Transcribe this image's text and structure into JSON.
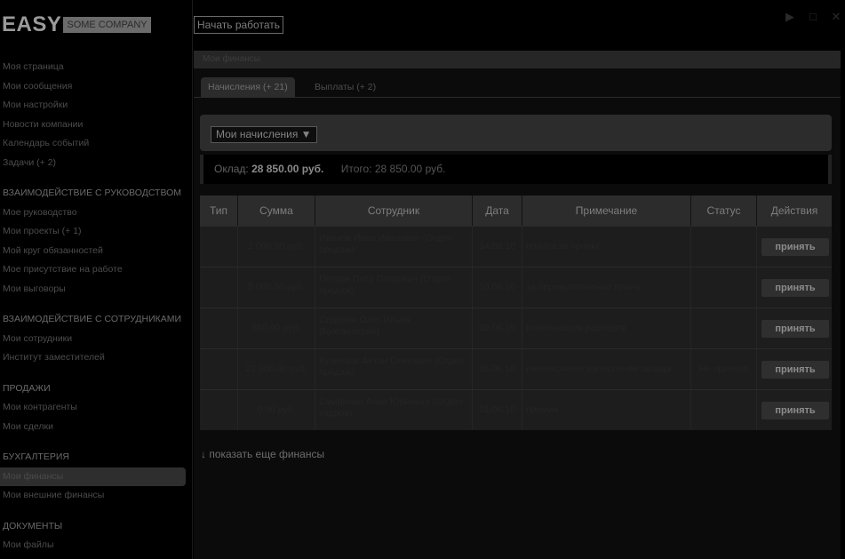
{
  "app": {
    "logo": "EASY",
    "logo_sub": "SOME COMPANY",
    "start_button": "Начать работать"
  },
  "sidebar": {
    "items": [
      {
        "label": "Моя страница"
      },
      {
        "label": "Мои сообщения"
      },
      {
        "label": "Мои настройки"
      },
      {
        "label": "Новости компании"
      },
      {
        "label": "Календарь событий"
      },
      {
        "label": "Задачи (+ 2)"
      }
    ],
    "sections": [
      {
        "title": "ВЗАИМОДЕЙСТВИЕ С РУКОВОДСТВОМ",
        "items": [
          "Мое руководство",
          "Мои проекты (+ 1)",
          "Мой круг обязанностей",
          "Мое присутствие на работе",
          "Мои выговоры"
        ]
      },
      {
        "title": "ВЗАИМОДЕЙСТВИЕ С СОТРУДНИКАМИ",
        "items": [
          "Мои сотрудники",
          "Институт заместителей"
        ]
      },
      {
        "title": "ПРОДАЖИ",
        "items": [
          "Мои контрагенты",
          "Мои сделки"
        ]
      },
      {
        "title": "БУХГАЛТЕРИЯ",
        "items": [
          "Мои финансы",
          "Мои внешние финансы"
        ]
      },
      {
        "title": "ДОКУМЕНТЫ",
        "items": [
          "Мои файлы"
        ]
      }
    ]
  },
  "panel": {
    "title": "Мои финансы",
    "tabs": [
      {
        "label": "Начисления (+ 21)",
        "active": true
      },
      {
        "label": "Выплаты (+ 2)",
        "active": false
      }
    ],
    "filter": {
      "selected": "Мои начисления ▼"
    },
    "summary": {
      "salary_label": "Оклад:",
      "salary_value": "28 850.00 руб.",
      "total": "Итого: 28 850.00 руб."
    },
    "table": {
      "columns": [
        "Тип",
        "Сумма",
        "Сотрудник",
        "Дата",
        "Примечание",
        "Статус",
        "Действия"
      ],
      "rows": [
        {
          "type": "",
          "sum": "1 000.00 руб.",
          "employee": "Иванов Иван Иванович (Отдел продаж)",
          "date": "14.06.10",
          "note": "оплата за проект",
          "status": "",
          "action": "принять"
        },
        {
          "type": "",
          "sum": "5 000.00 руб.",
          "employee": "Петров Петр Петрович (Отдел продаж)",
          "date": "10.06.10",
          "note": "за перевыполнение плана",
          "status": "",
          "action": "принять"
        },
        {
          "type": "",
          "sum": "850.00 руб.",
          "employee": "Сидоров Олег Ильич (Бухгалтерия)",
          "date": "09.06.10",
          "note": "компенсация расходов",
          "status": "",
          "action": "принять"
        },
        {
          "type": "",
          "sum": "22 000.00 руб.",
          "employee": "Кузнецов Антон Олегович (Отдел продаж)",
          "date": "05.06.10",
          "note": "ежемесячное начисление оклада",
          "status": "Не принято",
          "action": "принять"
        },
        {
          "type": "",
          "sum": "0.00 руб.",
          "employee": "Смирнова Анна Юрьевна (Отдел кадров)",
          "date": "01.06.10",
          "note": "премия",
          "status": "",
          "action": "принять"
        }
      ]
    },
    "more_link": "↓ показать еще финансы"
  },
  "window_controls": [
    "▶",
    "□",
    "✕"
  ]
}
